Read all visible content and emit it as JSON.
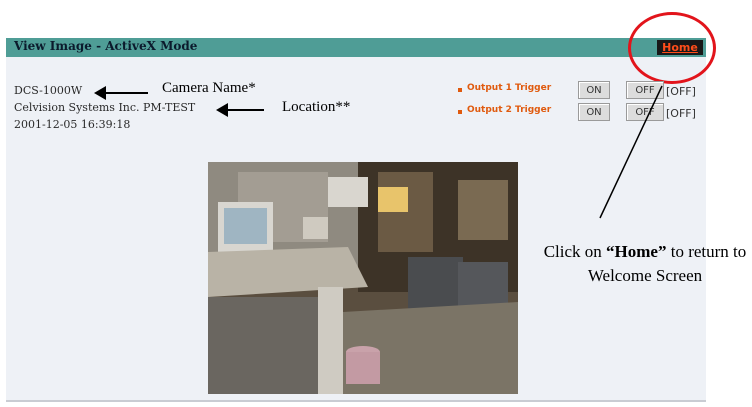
{
  "window": {
    "title": "View Image - ActiveX Mode",
    "home_label": "Home"
  },
  "camera": {
    "name": "DCS-1000W",
    "location": "Celvision Systems Inc. PM-TEST",
    "timestamp": "2001-12-05 16:39:18"
  },
  "annotations": {
    "camera_name": "Camera Name*",
    "location": "Location**",
    "click_prefix": "Click on ",
    "click_home": "“Home”",
    "click_suffix": " to return to Welcome Screen"
  },
  "outputs": [
    {
      "label": "Output 1 Trigger",
      "on_label": "ON",
      "off_label": "OFF",
      "state": "[OFF]"
    },
    {
      "label": "Output 2 Trigger",
      "on_label": "ON",
      "off_label": "OFF",
      "state": "[OFF]"
    }
  ],
  "colors": {
    "titlebar": "#4f9d96",
    "accent_orange": "#e05a0e",
    "highlight_circle": "#e2141b"
  },
  "icons": {
    "bullet": "bullet-icon",
    "pointer": "arrow-left-icon"
  }
}
